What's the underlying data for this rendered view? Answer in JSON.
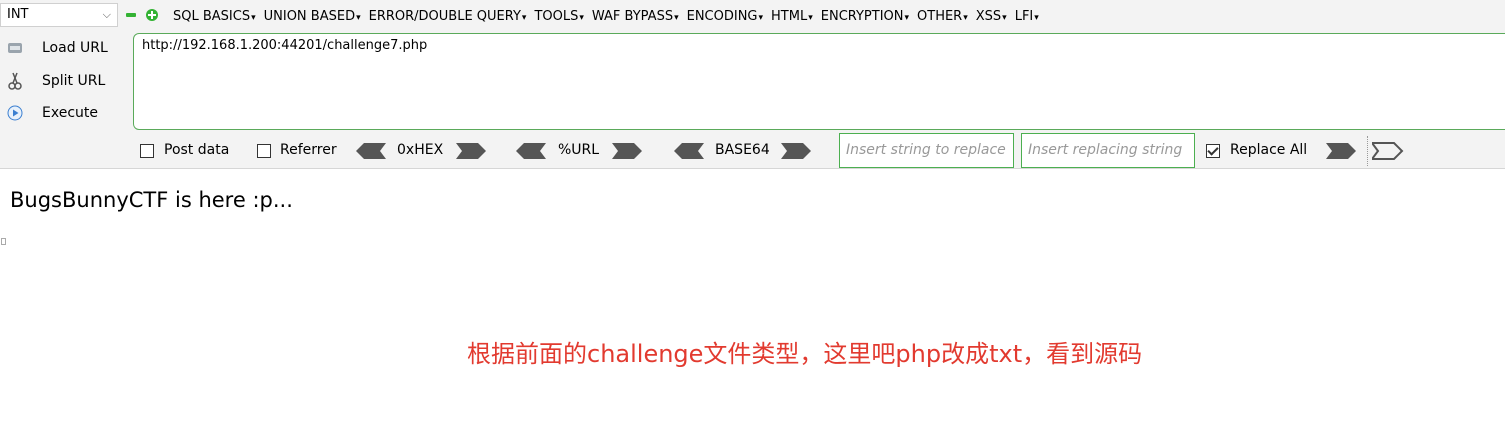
{
  "toolbar": {
    "type_select": "INT",
    "menus": [
      "SQL BASICS",
      "UNION BASED",
      "ERROR/DOUBLE QUERY",
      "TOOLS",
      "WAF BYPASS",
      "ENCODING",
      "HTML",
      "ENCRYPTION",
      "OTHER",
      "XSS",
      "LFI"
    ],
    "load_url": "Load URL",
    "split_url": "Split URL",
    "execute": "Execute",
    "url_value": "http://192.168.1.200:44201/challenge7.php",
    "post_data": "Post data",
    "referrer": "Referrer",
    "hex": "0xHEX",
    "url_enc": "%URL",
    "base64": "BASE64",
    "insert_placeholder": "Insert string to replace",
    "replacing_placeholder": "Insert replacing string",
    "replace_all": "Replace All",
    "replace_all_checked": true
  },
  "page": {
    "heading": "BugsBunnyCTF is here :p...",
    "annotation": "根据前面的challenge文件类型，这里吧php改成txt，看到源码"
  }
}
